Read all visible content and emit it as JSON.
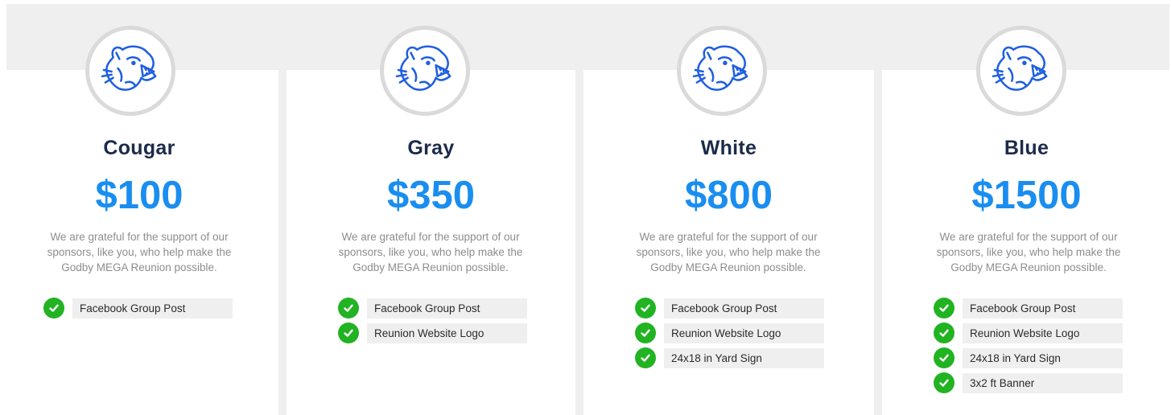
{
  "colors": {
    "accent_price": "#1a8ef0",
    "title": "#1c2b4a",
    "description": "#8d8d8d",
    "check": "#22b322",
    "benefit_bg": "#efefef",
    "mascot": "#1f5fe0"
  },
  "icons": {
    "mascot": "cougar-mascot-icon",
    "check": "check-circle-icon"
  },
  "tiers": [
    {
      "name": "Cougar",
      "price": "$100",
      "description": "We are grateful for the support of our sponsors, like you, who help make the Godby MEGA Reunion possible.",
      "benefits": [
        "Facebook Group Post"
      ]
    },
    {
      "name": "Gray",
      "price": "$350",
      "description": "We are grateful for the support of our sponsors, like you, who help make the Godby MEGA Reunion possible.",
      "benefits": [
        "Facebook Group Post",
        "Reunion Website Logo"
      ]
    },
    {
      "name": "White",
      "price": "$800",
      "description": "We are grateful for the support of our sponsors, like you, who help make the Godby MEGA Reunion possible.",
      "benefits": [
        "Facebook Group Post",
        "Reunion Website Logo",
        "24x18 in Yard Sign"
      ]
    },
    {
      "name": "Blue",
      "price": "$1500",
      "description": "We are grateful for the support of our sponsors, like you, who help make the Godby MEGA Reunion possible.",
      "benefits": [
        "Facebook Group Post",
        "Reunion Website Logo",
        "24x18 in Yard Sign",
        "3x2 ft Banner"
      ]
    }
  ]
}
